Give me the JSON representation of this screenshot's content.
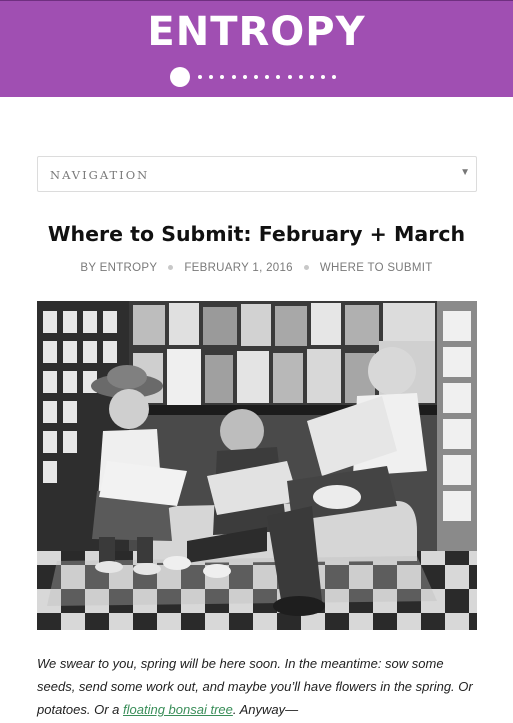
{
  "header": {
    "logo_text": "ENTROPY",
    "background_color": "#a04fb2"
  },
  "navigation": {
    "label": "NAVIGATION",
    "arrow_icon": "dropdown-arrow-icon"
  },
  "post": {
    "title": "Where to Submit: February + March",
    "meta": {
      "author": "BY ENTROPY",
      "date": "FEBRUARY 1, 2016",
      "category": "WHERE TO SUBMIT"
    },
    "image_alt": "Black and white photo of three children reading comic books in front of a magazine rack",
    "excerpt": {
      "before_link": "We swear to you, spring will be here soon. In the meantime: sow some seeds, send some work out, and maybe you’ll have flowers in the spring. Or potatoes. Or a ",
      "link_text": "floating bonsai tree",
      "after_link": ". Anyway—"
    }
  }
}
